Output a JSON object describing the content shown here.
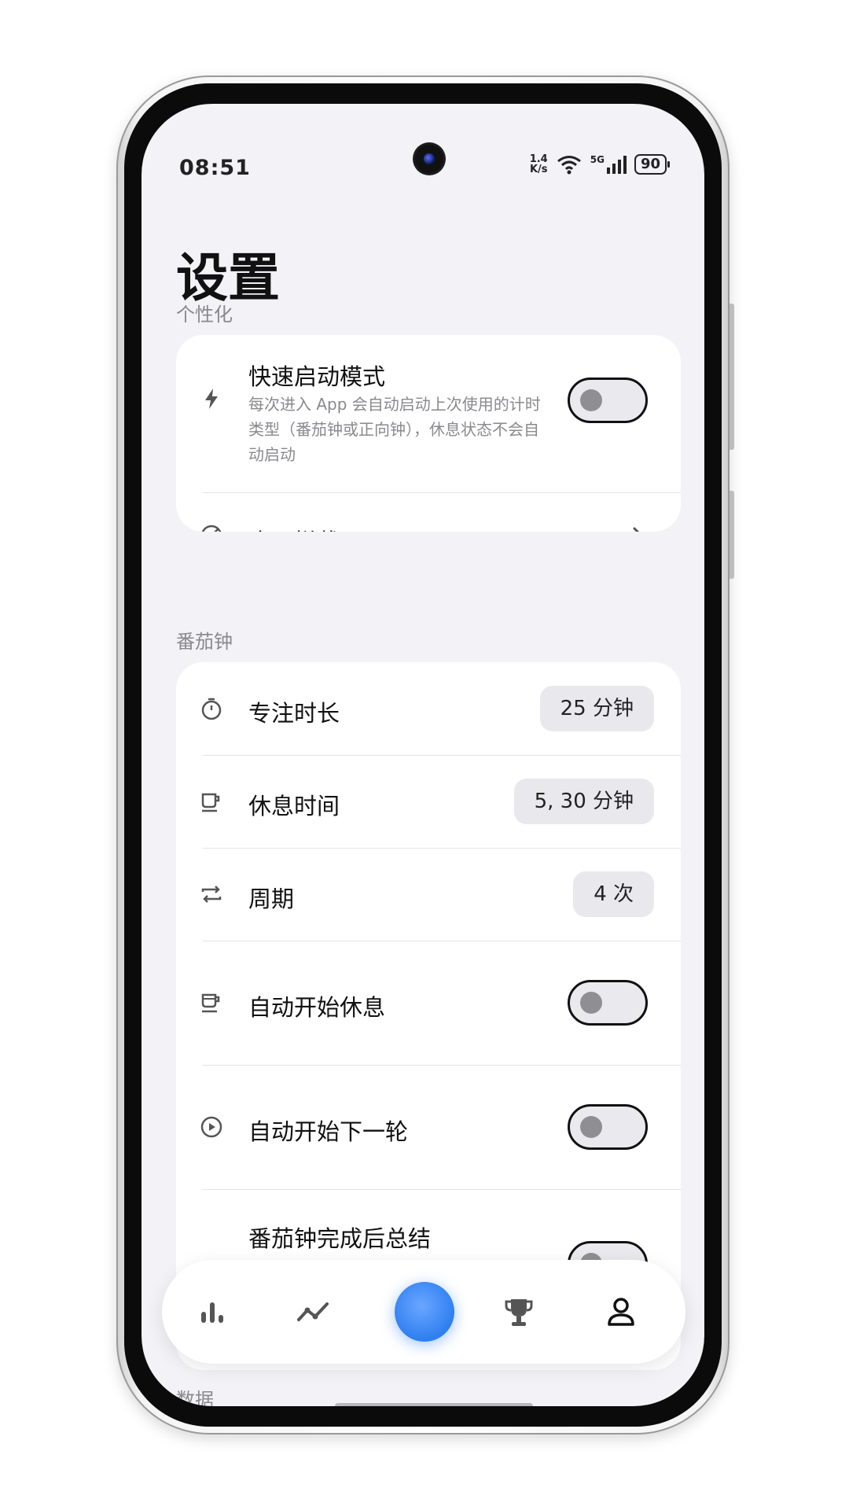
{
  "status_bar": {
    "time": "08:51",
    "net_speed_value": "1.4",
    "net_speed_unit": "K/s",
    "signal_label": "5G",
    "battery": "90"
  },
  "page": {
    "title": "设置"
  },
  "sections": {
    "personalize": {
      "label": "个性化",
      "quick_start": {
        "title": "快速启动模式",
        "desc": "每次进入 App 会自动启动上次使用的计时类型（番茄钟或正向钟），休息状态不会自动启动",
        "enabled": false
      },
      "app_block": {
        "title": "应用拦截"
      }
    },
    "pomodoro": {
      "label": "番茄钟",
      "focus_duration": {
        "title": "专注时长",
        "value": "25 分钟"
      },
      "break_time": {
        "title": "休息时间",
        "value": "5, 30 分钟"
      },
      "cycle": {
        "title": "周期",
        "value": "4 次"
      },
      "auto_start_break": {
        "title": "自动开始休息",
        "enabled": false
      },
      "auto_start_next": {
        "title": "自动开始下一轮",
        "enabled": false
      },
      "summary_after": {
        "title": "番茄钟完成后总结"
      }
    },
    "data_peek": {
      "label": "数据"
    }
  },
  "bottom_nav": {
    "items": [
      {
        "icon": "bar-chart-icon"
      },
      {
        "icon": "trend-line-icon"
      },
      {
        "icon": "start-timer-button"
      },
      {
        "icon": "trophy-icon"
      },
      {
        "icon": "profile-icon",
        "active": true
      }
    ]
  },
  "colors": {
    "accent": "#2f7ff0",
    "background": "#f2f2f7",
    "card": "#ffffff"
  }
}
